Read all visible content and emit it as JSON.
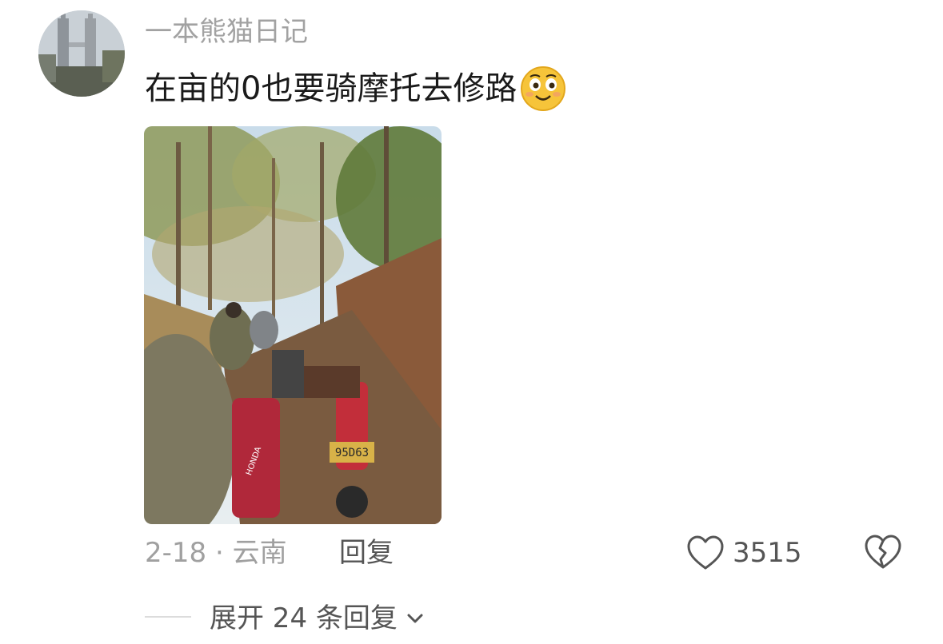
{
  "comment": {
    "username": "一本熊猫日记",
    "text": "在亩的0也要骑摩托去修路",
    "emoji_icon": "smiling-face-emoji-icon",
    "photo_plate_text": "95D63",
    "photo_brand_text": "HONDA"
  },
  "meta": {
    "date_location": "2-18 · 云南",
    "reply_label": "回复",
    "like_count": "3515"
  },
  "expand": {
    "label": "展开 24 条回复"
  },
  "colors": {
    "username": "#a2a2a2",
    "text": "#1a1a1a",
    "secondary": "#555555"
  }
}
